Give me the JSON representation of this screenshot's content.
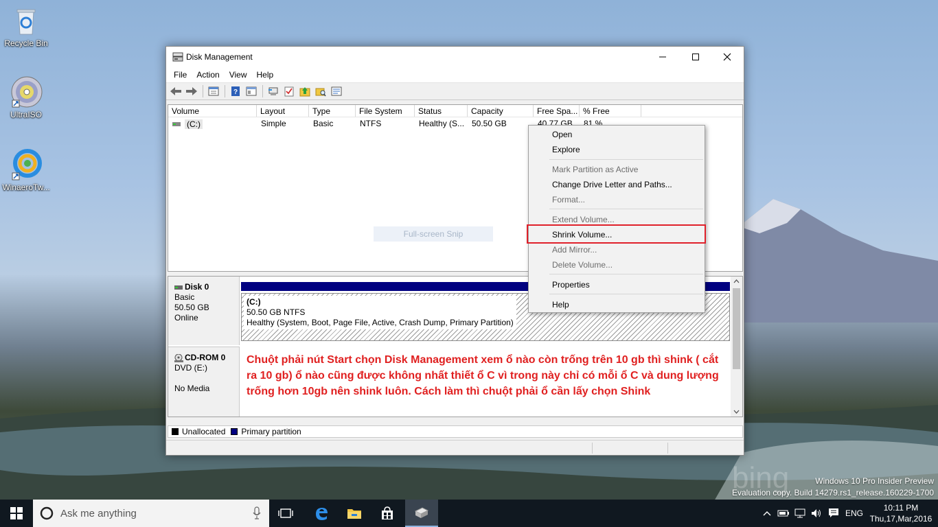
{
  "desktop": {
    "icons": [
      {
        "label": "Recycle Bin"
      },
      {
        "label": "UltraISO"
      },
      {
        "label": "WinaeroTw..."
      }
    ]
  },
  "window": {
    "title": "Disk Management",
    "menu": [
      "File",
      "Action",
      "View",
      "Help"
    ],
    "toolbar_icons": [
      "back-icon",
      "forward-icon",
      "console-tree-icon",
      "help-icon",
      "properties-icon",
      "connect-icon",
      "check-icon",
      "folder-up-icon",
      "folder-search-icon",
      "view-icon"
    ],
    "columns": [
      "Volume",
      "Layout",
      "Type",
      "File System",
      "Status",
      "Capacity",
      "Free Spa...",
      "% Free"
    ],
    "volumes": [
      {
        "volume": "(C:)",
        "layout": "Simple",
        "type": "Basic",
        "fs": "NTFS",
        "status": "Healthy (S...",
        "capacity": "50.50 GB",
        "free": "40.77 GB",
        "pct": "81 %"
      }
    ],
    "snip_label": "Full-screen Snip",
    "disks": [
      {
        "name": "Disk 0",
        "type": "Basic",
        "size": "50.50 GB",
        "state": "Online"
      },
      {
        "name": "CD-ROM 0",
        "type": "DVD (E:)",
        "size": "",
        "state": "No Media"
      }
    ],
    "partition": {
      "label": "(C:)",
      "size": "50.50 GB NTFS",
      "status": "Healthy (System, Boot, Page File, Active, Crash Dump, Primary Partition)"
    },
    "annotation": "Chuột phải nút Start chọn Disk Management xem ổ nào còn trống trên 10 gb thì shink ( cắt ra 10 gb) ổ nào cũng được không nhất thiết ổ C vì trong này chỉ có mỗi ổ C và dung lượng trống hơn 10gb nên shink luôn. Cách làm thì chuột phải ổ cần lấy chọn Shink",
    "legend": [
      {
        "label": "Unallocated",
        "color": "#000000"
      },
      {
        "label": "Primary partition",
        "color": "#000080"
      }
    ]
  },
  "context_menu": {
    "items": [
      {
        "label": "Open",
        "disabled": false
      },
      {
        "label": "Explore",
        "disabled": false
      },
      {
        "label": "Mark Partition as Active",
        "disabled": true
      },
      {
        "label": "Change Drive Letter and Paths...",
        "disabled": false
      },
      {
        "label": "Format...",
        "disabled": true
      },
      {
        "label": "Extend Volume...",
        "disabled": true
      },
      {
        "label": "Shrink Volume...",
        "disabled": false,
        "highlighted": true
      },
      {
        "label": "Add Mirror...",
        "disabled": true
      },
      {
        "label": "Delete Volume...",
        "disabled": true
      },
      {
        "label": "Properties",
        "disabled": false
      },
      {
        "label": "Help",
        "disabled": false
      }
    ],
    "highlight_color": "#e0202a"
  },
  "watermark": {
    "line1": "Windows 10 Pro Insider Preview",
    "line2": "Evaluation copy. Build 14279.rs1_release.160229-1700",
    "brand": "bing"
  },
  "taskbar": {
    "search_placeholder": "Ask me anything",
    "language": "ENG",
    "time": "10:11 PM",
    "date": "Thu,17,Mar,2016"
  }
}
